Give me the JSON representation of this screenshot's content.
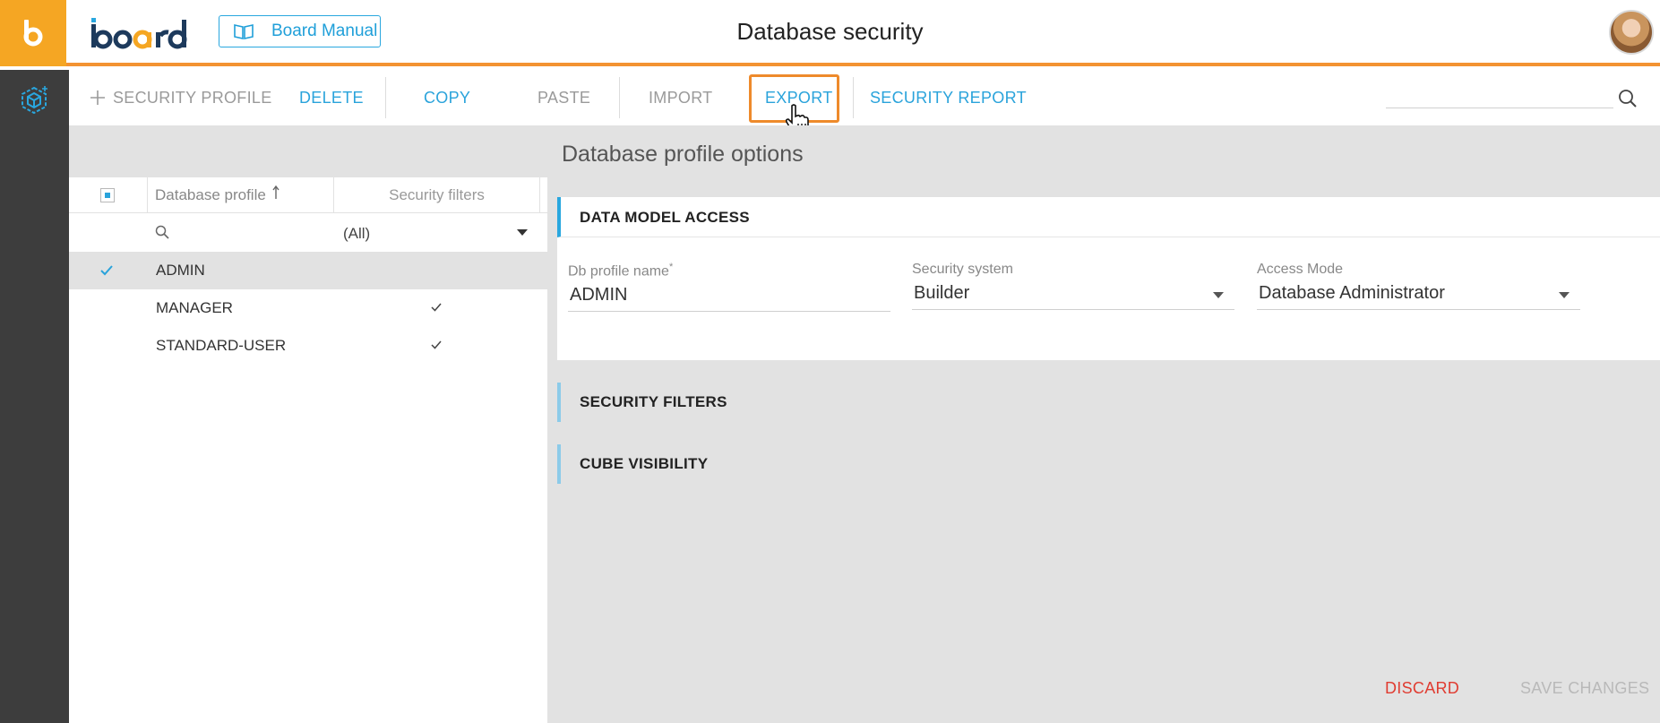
{
  "header": {
    "manual_label": "Board Manual",
    "page_title": "Database security"
  },
  "toolbar": {
    "add_profile": "SECURITY PROFILE",
    "delete": "DELETE",
    "copy": "COPY",
    "paste": "PASTE",
    "import": "IMPORT",
    "export": "EXPORT",
    "security_report": "SECURITY REPORT",
    "search_value": ""
  },
  "table": {
    "col_profile": "Database profile",
    "col_filters": "Security filters",
    "filter_value": "(All)",
    "rows": [
      {
        "name": "ADMIN",
        "selected": true,
        "security_filters": false
      },
      {
        "name": "MANAGER",
        "selected": false,
        "security_filters": true
      },
      {
        "name": "STANDARD-USER",
        "selected": false,
        "security_filters": true
      }
    ]
  },
  "options": {
    "title": "Database profile options",
    "data_model_access": "DATA MODEL ACCESS",
    "db_profile_name_label": "Db profile name",
    "required_mark": "*",
    "db_profile_name": "ADMIN",
    "security_system_label": "Security system",
    "security_system": "Builder",
    "access_mode_label": "Access Mode",
    "access_mode": "Database Administrator",
    "security_filters": "SECURITY FILTERS",
    "cube_visibility": "CUBE VISIBILITY"
  },
  "actions": {
    "discard": "DISCARD",
    "save": "SAVE CHANGES"
  },
  "colors": {
    "accent": "#29a7df",
    "brand_orange": "#f5a623",
    "highlight_orange": "#ee8a2b",
    "danger": "#e03c31",
    "rail": "#3d3d3d"
  }
}
